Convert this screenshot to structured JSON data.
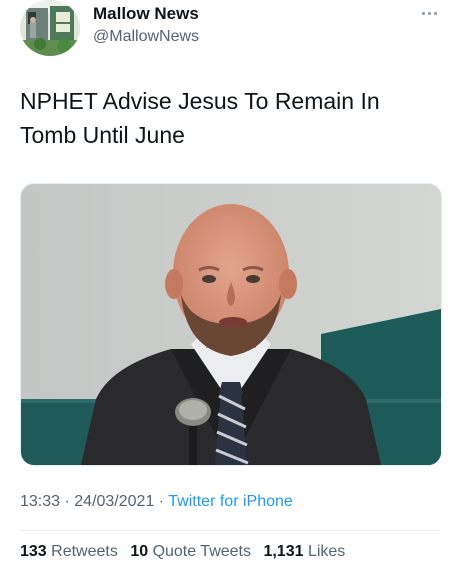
{
  "author": {
    "display_name": "Mallow News",
    "handle": "@MallowNews",
    "avatar_icon": "avatar-photo-icon"
  },
  "more_icon": "more-horizontal-icon",
  "tweet": {
    "text_line1": "NPHET Advise Jesus To Remain In",
    "text_line2": "Tomb Until June",
    "media_icon": "photo-man-at-microphone"
  },
  "meta": {
    "time": "13:33",
    "separator1": " · ",
    "date": "24/03/2021",
    "separator2": " · ",
    "source": "Twitter for iPhone"
  },
  "stats": {
    "retweets_count": "133",
    "retweets_label": "Retweets",
    "quotes_count": "10",
    "quotes_label": "Quote Tweets",
    "likes_count": "1,131",
    "likes_label": "Likes"
  },
  "colors": {
    "link": "#1d9bf0",
    "secondary_text": "#536471",
    "primary_text": "#0f1419"
  }
}
